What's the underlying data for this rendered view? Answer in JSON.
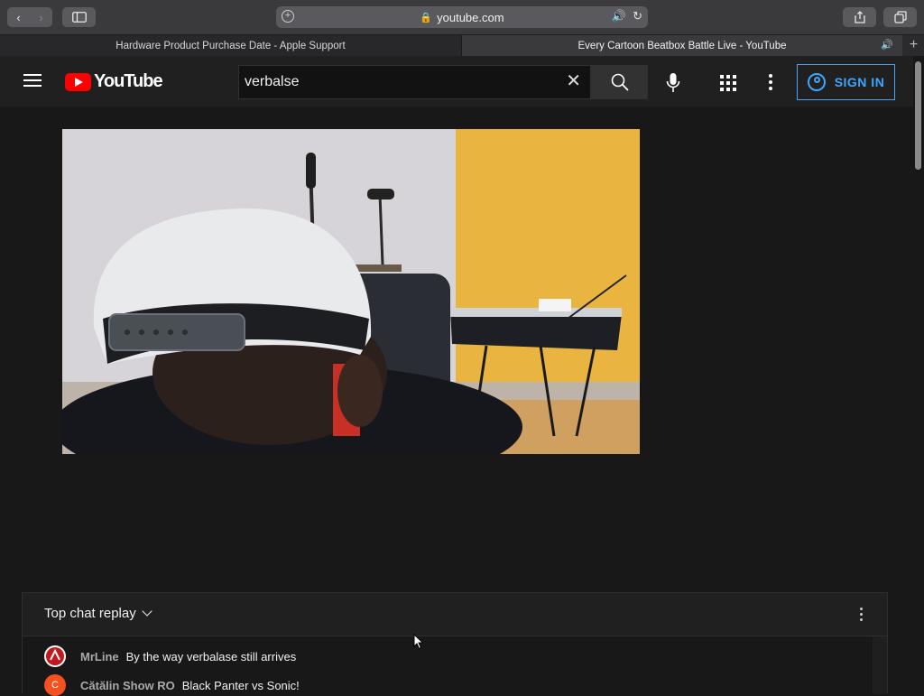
{
  "browser": {
    "url": "youtube.com",
    "tabs": [
      {
        "label": "Hardware Product Purchase Date - Apple Support"
      },
      {
        "label": "Every Cartoon Beatbox Battle Live - YouTube"
      }
    ]
  },
  "youtube": {
    "logo_text": "YouTube",
    "search_value": "verbalse",
    "sign_in_label": "SIGN IN",
    "accent_color": "#3ea6ff",
    "brand_color": "#ff0000"
  },
  "chat": {
    "title": "Top chat replay",
    "messages": [
      {
        "author": "MrLine",
        "text": "By the way verbalase still arrives",
        "avatar_letter": "",
        "avatar_color": "#c4161c"
      },
      {
        "author": "Cătălin Show RO",
        "text": "Black Panter vs Sonic!",
        "avatar_letter": "C",
        "avatar_color": "#f4511e"
      }
    ]
  }
}
